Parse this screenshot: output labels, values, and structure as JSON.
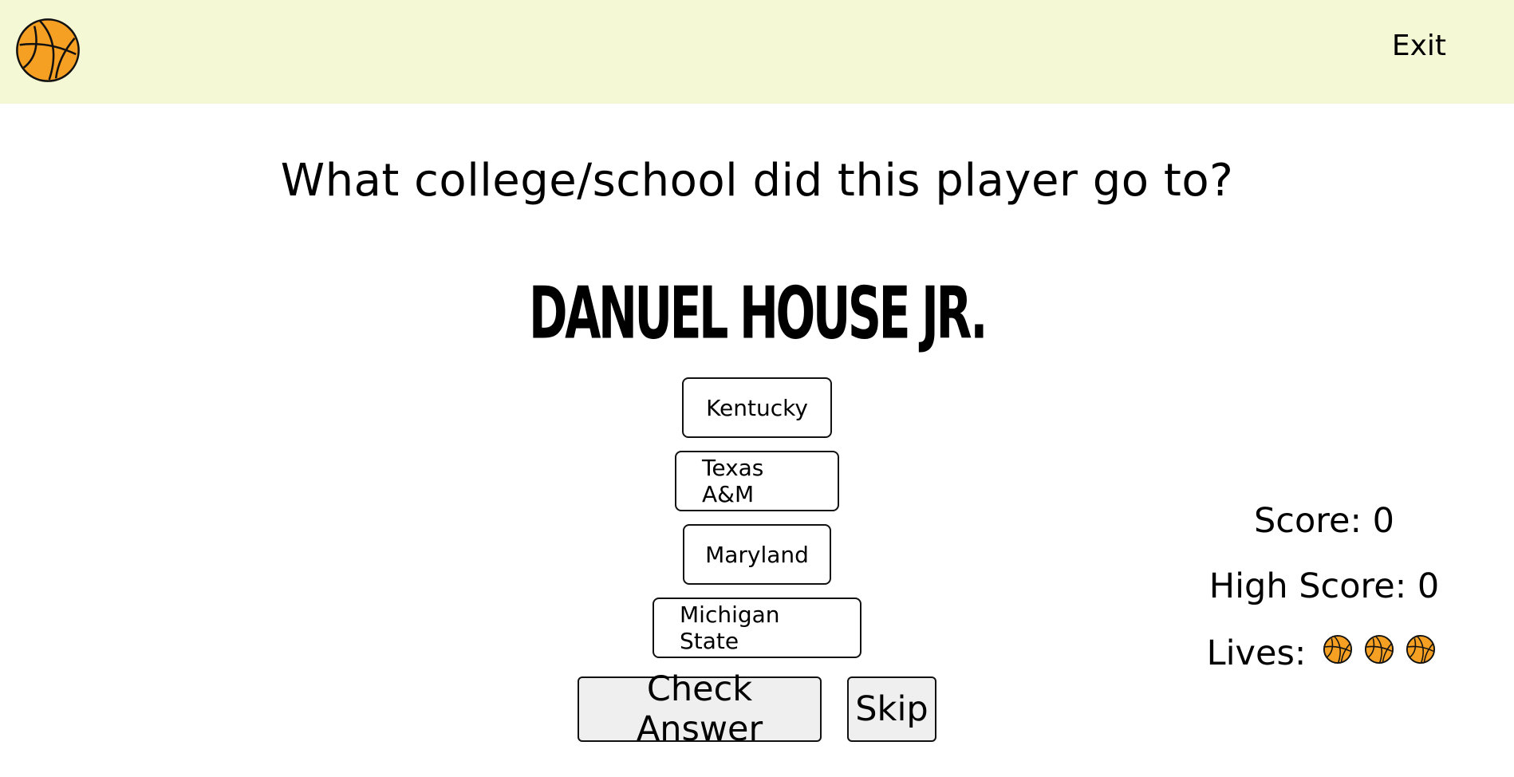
{
  "header": {
    "logo_icon": "basketball-icon",
    "exit_label": "Exit",
    "background": "#f4f8d4"
  },
  "question": {
    "text": "What college/school did this player go to?"
  },
  "player": {
    "name": "Danuel House Jr."
  },
  "options": [
    {
      "label": "Kentucky"
    },
    {
      "label": "Texas A&M"
    },
    {
      "label": "Maryland"
    },
    {
      "label": "Michigan State"
    }
  ],
  "actions": {
    "check_label": "Check Answer",
    "skip_label": "Skip"
  },
  "stats": {
    "score_text": "Score: 0",
    "high_score_text": "High Score: 0",
    "lives_label": "Lives:",
    "lives_count": 3,
    "life_icon": "basketball-icon"
  },
  "colors": {
    "ball_orange": "#f5a023",
    "outline": "#111111"
  }
}
